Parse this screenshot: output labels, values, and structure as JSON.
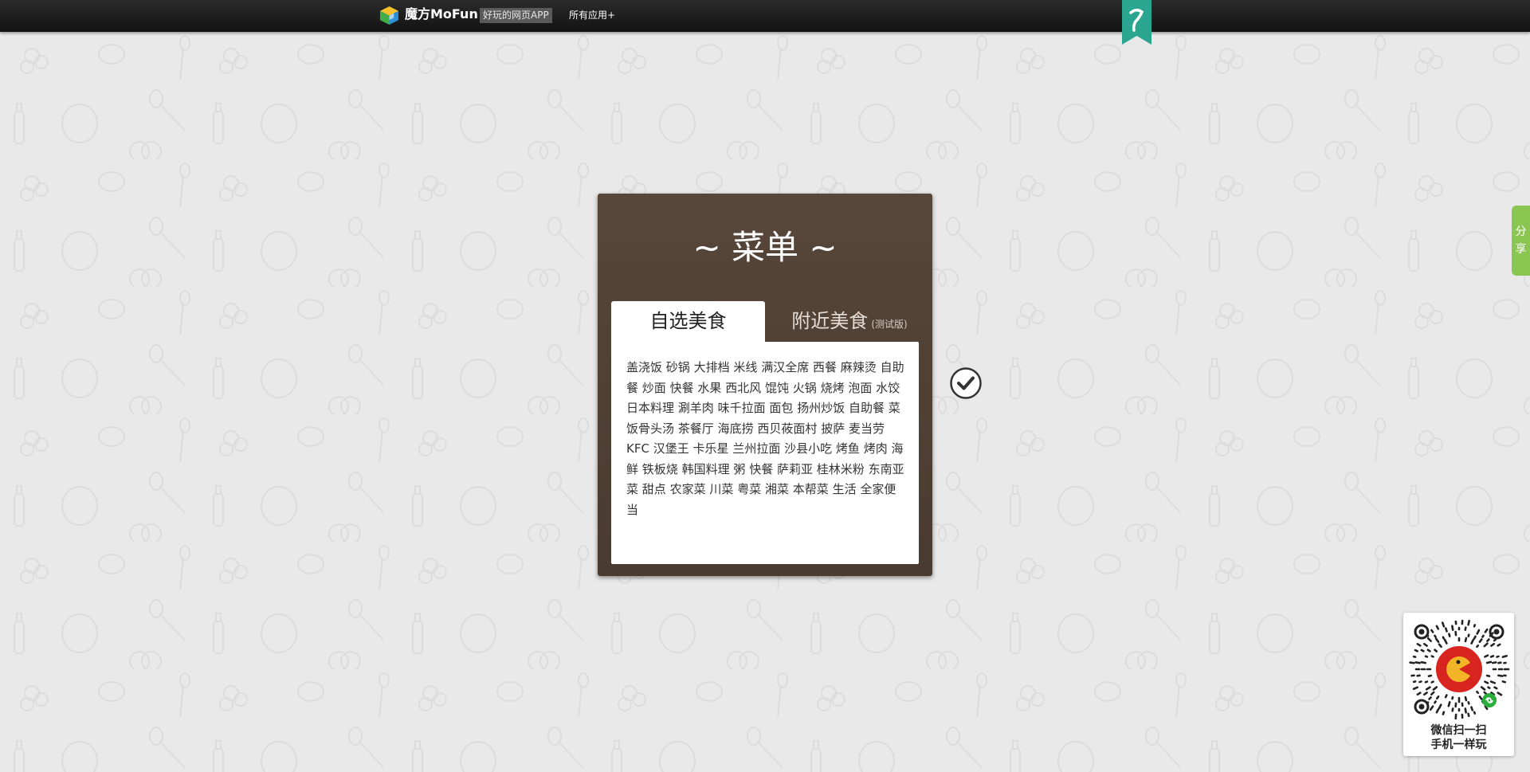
{
  "header": {
    "logo_text": "魔方MoFun",
    "slogan": "好玩的网页APP",
    "all_apps_link": "所有应用+",
    "ribbon_icon": "mofun-ribbon-icon"
  },
  "card": {
    "title": "~ 菜单 ~",
    "tabs": [
      {
        "label": "自选美食",
        "note": "",
        "active": true
      },
      {
        "label": "附近美食",
        "note": "(测试版)",
        "active": false
      }
    ],
    "menu_items": [
      "盖浇饭",
      "砂锅",
      "大排档",
      "米线",
      "满汉全席",
      "西餐",
      "麻辣烫",
      "自助餐",
      "炒面",
      "快餐",
      "水果",
      "西北风",
      "馄饨",
      "火锅",
      "烧烤",
      "泡面",
      "水饺",
      "日本料理",
      "涮羊肉",
      "味千拉面",
      "面包",
      "扬州炒饭",
      "自助餐",
      "菜饭骨头汤",
      "茶餐厅",
      "海底捞",
      "西贝莜面村",
      "披萨",
      "麦当劳",
      "KFC",
      "汉堡王",
      "卡乐星",
      "兰州拉面",
      "沙县小吃",
      "烤鱼",
      "烤肉",
      "海鲜",
      "铁板烧",
      "韩国料理",
      "粥",
      "快餐",
      "萨莉亚",
      "桂林米粉",
      "东南亚菜",
      "甜点",
      "农家菜",
      "川菜",
      "粤菜",
      "湘菜",
      "本帮菜",
      "生活",
      "全家便当"
    ]
  },
  "check_button": {
    "icon": "checkmark-icon"
  },
  "share": {
    "label": "分享"
  },
  "qr": {
    "caption_line1": "微信扫一扫",
    "caption_line2": "手机一样玩",
    "icon": "qr-code-icon"
  },
  "colors": {
    "topbar": "#1a1a1a",
    "card_bg": "#524237",
    "share_green": "#8cc652",
    "ribbon_teal": "#2aa590",
    "qr_red": "#d8241f"
  }
}
